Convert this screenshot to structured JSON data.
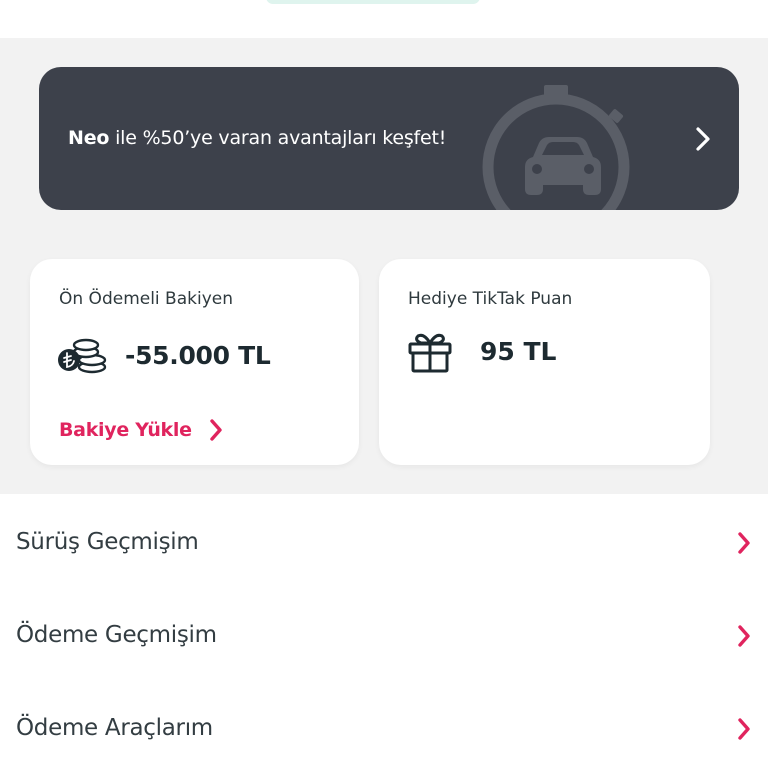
{
  "promo": {
    "brand": "Neo",
    "text": " ile %50’ye varan avantajları keşfet!"
  },
  "prepaid": {
    "title": "Ön Ödemeli Bakiyen",
    "value": "-55.000 TL",
    "action_label": "Bakiye Yükle"
  },
  "gift_points": {
    "title": "Hediye TikTak Puan",
    "value": "95 TL"
  },
  "menu": {
    "items": [
      {
        "label": "Sürüş Geçmişim"
      },
      {
        "label": "Ödeme Geçmişim"
      },
      {
        "label": "Ödeme Araçlarım"
      }
    ]
  },
  "colors": {
    "accent": "#e0245e",
    "banner": "#3d414b",
    "background": "#f2f2f2",
    "card": "#ffffff",
    "dark_text": "#1d2a30"
  },
  "icons": [
    "stopwatch-car-icon",
    "chevron-right-icon",
    "coins-icon",
    "gift-icon"
  ]
}
